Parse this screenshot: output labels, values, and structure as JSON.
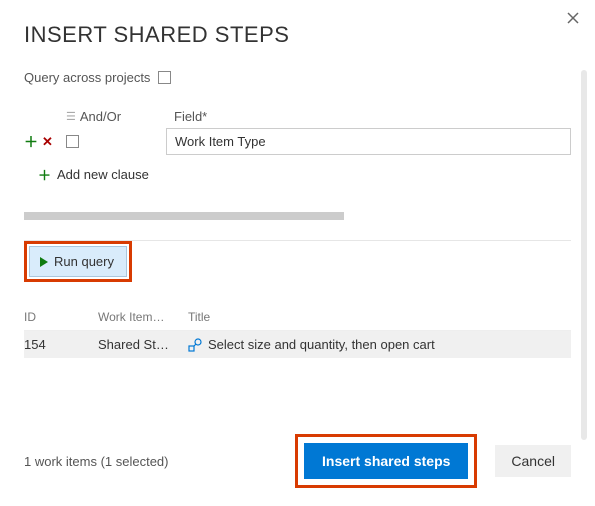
{
  "dialog": {
    "title": "INSERT SHARED STEPS",
    "query_across_label": "Query across projects",
    "headers": {
      "andor": "And/Or",
      "field": "Field*"
    },
    "field_value": "Work Item Type",
    "add_clause_label": "Add new clause",
    "run_query_label": "Run query"
  },
  "results": {
    "columns": {
      "id": "ID",
      "type": "Work Item…",
      "title": "Title"
    },
    "rows": [
      {
        "id": "154",
        "type": "Shared St…",
        "title": "Select size and quantity, then open cart"
      }
    ]
  },
  "footer": {
    "status": "1 work items (1 selected)",
    "insert_label": "Insert shared steps",
    "cancel_label": "Cancel"
  },
  "colors": {
    "primary": "#0078d4",
    "highlight": "#d83b01",
    "green": "#107c10",
    "red": "#a80000"
  }
}
